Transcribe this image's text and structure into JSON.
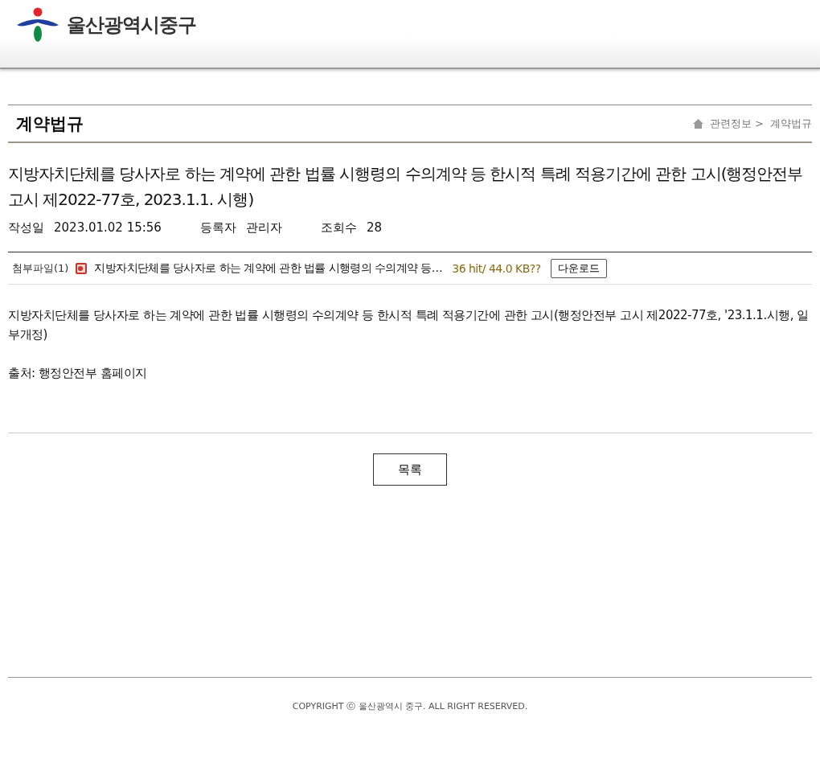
{
  "site": {
    "name": "울산광역시중구"
  },
  "page": {
    "heading": "계약법규",
    "breadcrumb": [
      "관련정보 >",
      "계약법규"
    ]
  },
  "post": {
    "title": "지방자치단체를 당사자로 하는 계약에 관한 법률 시행령의 수의계약 등 한시적 특례 적용기간에 관한 고시(행정안전부 고시 제2022-77호, 2023.1.1. 시행)",
    "meta": [
      {
        "label": "작성일",
        "value": "2023.01.02 15:56"
      },
      {
        "label": "등록자",
        "value": "관리자"
      },
      {
        "label": "조회수",
        "value": "28"
      }
    ],
    "attachment": {
      "label": "첨부파일(1)",
      "file": "지방자치단체를 당사자로 하는 계약에 관한 법률 시행령의 수의계약 등…",
      "info": "36 hit/ 44.0 KB??",
      "button": "다운로드"
    },
    "body": [
      "지방자치단체를 당사자로 하는 계약에 관한 법률 시행령의 수의계약 등 한시적 특례 적용기간에 관한 고시(행정안전부 고시 제2022-77호, '23.1.1.시행, 일부개정)",
      "출처: 행정안전부 홈페이지"
    ]
  },
  "list_button": "목록",
  "footer": {
    "copyright": "COPYRIGHT ⓒ 울산광역시 중구. ALL RIGHT RESERVED."
  }
}
